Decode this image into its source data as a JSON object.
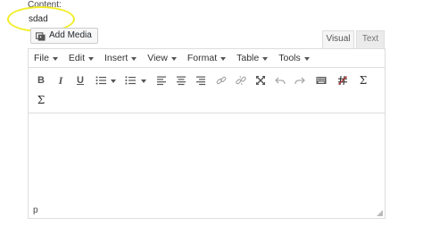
{
  "form": {
    "content_label": "Content:",
    "content_value": "sdad"
  },
  "editor": {
    "add_media_label": "Add Media",
    "tabs": {
      "visual": "Visual",
      "text": "Text"
    },
    "menus": [
      "File",
      "Edit",
      "Insert",
      "View",
      "Format",
      "Table",
      "Tools"
    ],
    "toolbar_icons": [
      "bold-icon",
      "italic-icon",
      "underline-icon",
      "bullet-list-icon",
      "numbered-list-icon",
      "align-left-icon",
      "align-center-icon",
      "align-right-icon",
      "link-icon",
      "unlink-icon",
      "fullscreen-icon",
      "undo-icon",
      "redo-icon",
      "keyboard-icon",
      "strikethrough-icon",
      "sigma-icon",
      "sigma-icon"
    ],
    "toolbar_symbols": {
      "bold": "B",
      "italic": "I",
      "underline": "U",
      "sigma": "Σ"
    },
    "path": "p"
  },
  "colors": {
    "highlight": "#f2ee29",
    "border": "#dddddd",
    "strike_accent": "#b32d2e"
  }
}
